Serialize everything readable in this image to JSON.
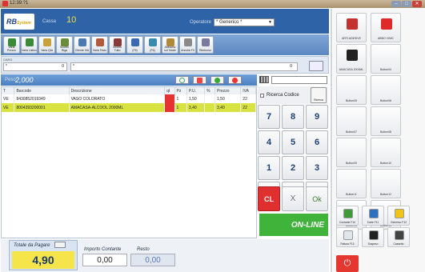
{
  "window": {
    "title": "12:39:?1"
  },
  "header": {
    "logo": "RB",
    "logo_sub": "System",
    "cassa_label": "Cassa",
    "cassa_value": "10",
    "operatore_label": "Operatore",
    "operatore_value": "* Generico *"
  },
  "toolbar": {
    "buttons": [
      {
        "label": "Varia Prezzo",
        "icon": "money-edit-icon"
      },
      {
        "label": "Varia Listino",
        "icon": "money-list-icon"
      },
      {
        "label": "Varia Qtà",
        "icon": "qty-icon"
      },
      {
        "label": "Sconto Riga",
        "icon": "percent-icon"
      },
      {
        "label": "Cliente IVA",
        "icon": "user-icon"
      },
      {
        "label": "Varia Testo",
        "icon": "pencil-icon"
      },
      {
        "label": "Sconto Tutto",
        "icon": "percent-icon"
      },
      {
        "label": "(F5)",
        "icon": "bag-icon"
      },
      {
        "label": "(F6)",
        "icon": "calc-icon"
      },
      {
        "label": "Abbuono sul Totale",
        "icon": "coins-icon"
      },
      {
        "label": "Annulla F3",
        "icon": "cancel-icon"
      },
      {
        "label": "Rimborso",
        "icon": "refund-icon"
      }
    ]
  },
  "codebar": {
    "label": "CARD",
    "field1_prefix": "*",
    "field1_value": "0",
    "field2_prefix": "*",
    "field2_value": "0"
  },
  "peso": {
    "label": "Peso",
    "value": "2,000"
  },
  "grid": {
    "columns": [
      "T",
      "Barcode",
      "Descrizione",
      "qt",
      "Pz",
      "P.U.",
      "%",
      "Prezzo",
      "IVA"
    ],
    "rows": [
      [
        "VE",
        "8430852019349",
        "VASO COLORATO",
        "",
        "1",
        "1,50",
        "",
        "1,50",
        "22"
      ],
      [
        "VE",
        "8004393200001",
        "AMACASA-ALCOOL 2000ML",
        "",
        "1",
        "3,40",
        "",
        "3,40",
        "22"
      ]
    ]
  },
  "ricerca": {
    "label": "Ricerca Codice",
    "button": "Ricerca"
  },
  "keypad": [
    "7",
    "8",
    "9",
    "4",
    "5",
    "6",
    "1",
    "2",
    "3",
    "0",
    "00",
    ","
  ],
  "actions": {
    "cl": "CL",
    "x": "X",
    "ok": "Ok"
  },
  "status": {
    "online": "ON-LINE"
  },
  "totals": {
    "totale_label": "Totale da Pagare",
    "totale_value": "4,90",
    "importo_label": "Importo Contante",
    "importo_value": "0,00",
    "resto_label": "Resto",
    "resto_value": "0,00"
  },
  "products": [
    {
      "label": "ARTI ADESIVE",
      "icon": "tag-icon"
    },
    {
      "label": "ABBO VINIC",
      "icon": "medical-icon"
    },
    {
      "label": "AMACASA 2000ML",
      "icon": "glasses-icon"
    },
    {
      "label": "Button04",
      "icon": ""
    },
    {
      "label": "Button05",
      "icon": ""
    },
    {
      "label": "Button06",
      "icon": ""
    },
    {
      "label": "Button07",
      "icon": ""
    },
    {
      "label": "Button08",
      "icon": ""
    },
    {
      "label": "Button09",
      "icon": ""
    },
    {
      "label": "Button10",
      "icon": ""
    },
    {
      "label": "Button11",
      "icon": ""
    },
    {
      "label": "Button12",
      "icon": ""
    },
    {
      "label": "Button13",
      "icon": ""
    },
    {
      "label": "Button14",
      "icon": ""
    }
  ],
  "functions": [
    {
      "label": "Contante F10",
      "icon": "cash-icon"
    },
    {
      "label": "Carte F11",
      "icon": "card-icon"
    },
    {
      "label": "Generico F12",
      "icon": "warning-icon"
    },
    {
      "label": "Fattura F13",
      "icon": "document-icon"
    },
    {
      "label": "Sospeso",
      "icon": "grid-icon"
    },
    {
      "label": "Cassetto",
      "icon": "drawer-icon"
    }
  ],
  "power_icon": "power-icon"
}
